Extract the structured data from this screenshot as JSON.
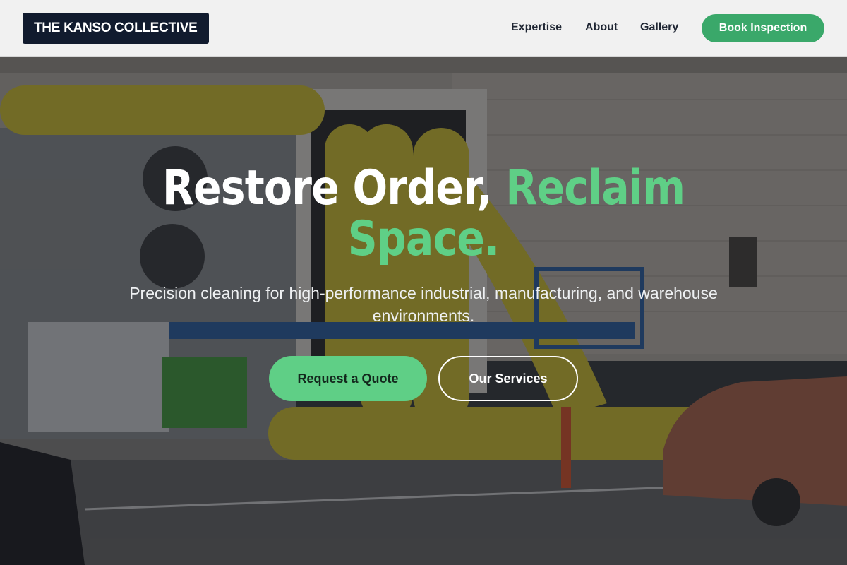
{
  "brand": {
    "name": "THE KANSO COLLECTIVE"
  },
  "nav": {
    "links": [
      {
        "label": "Expertise"
      },
      {
        "label": "About"
      },
      {
        "label": "Gallery"
      }
    ],
    "cta_label": "Book Inspection"
  },
  "hero": {
    "headline_white": "Restore Order, ",
    "headline_accent_1": "Reclaim",
    "headline_accent_2": "Space.",
    "subtitle": "Precision cleaning for high-performance industrial, manufacturing, and warehouse environments.",
    "primary_button": "Request a Quote",
    "secondary_button": "Our Services"
  },
  "colors": {
    "brand_bg": "#111b2e",
    "accent_green": "#5fcf86",
    "cta_green": "#3aa86a",
    "nav_bg": "#f1f1f1"
  }
}
